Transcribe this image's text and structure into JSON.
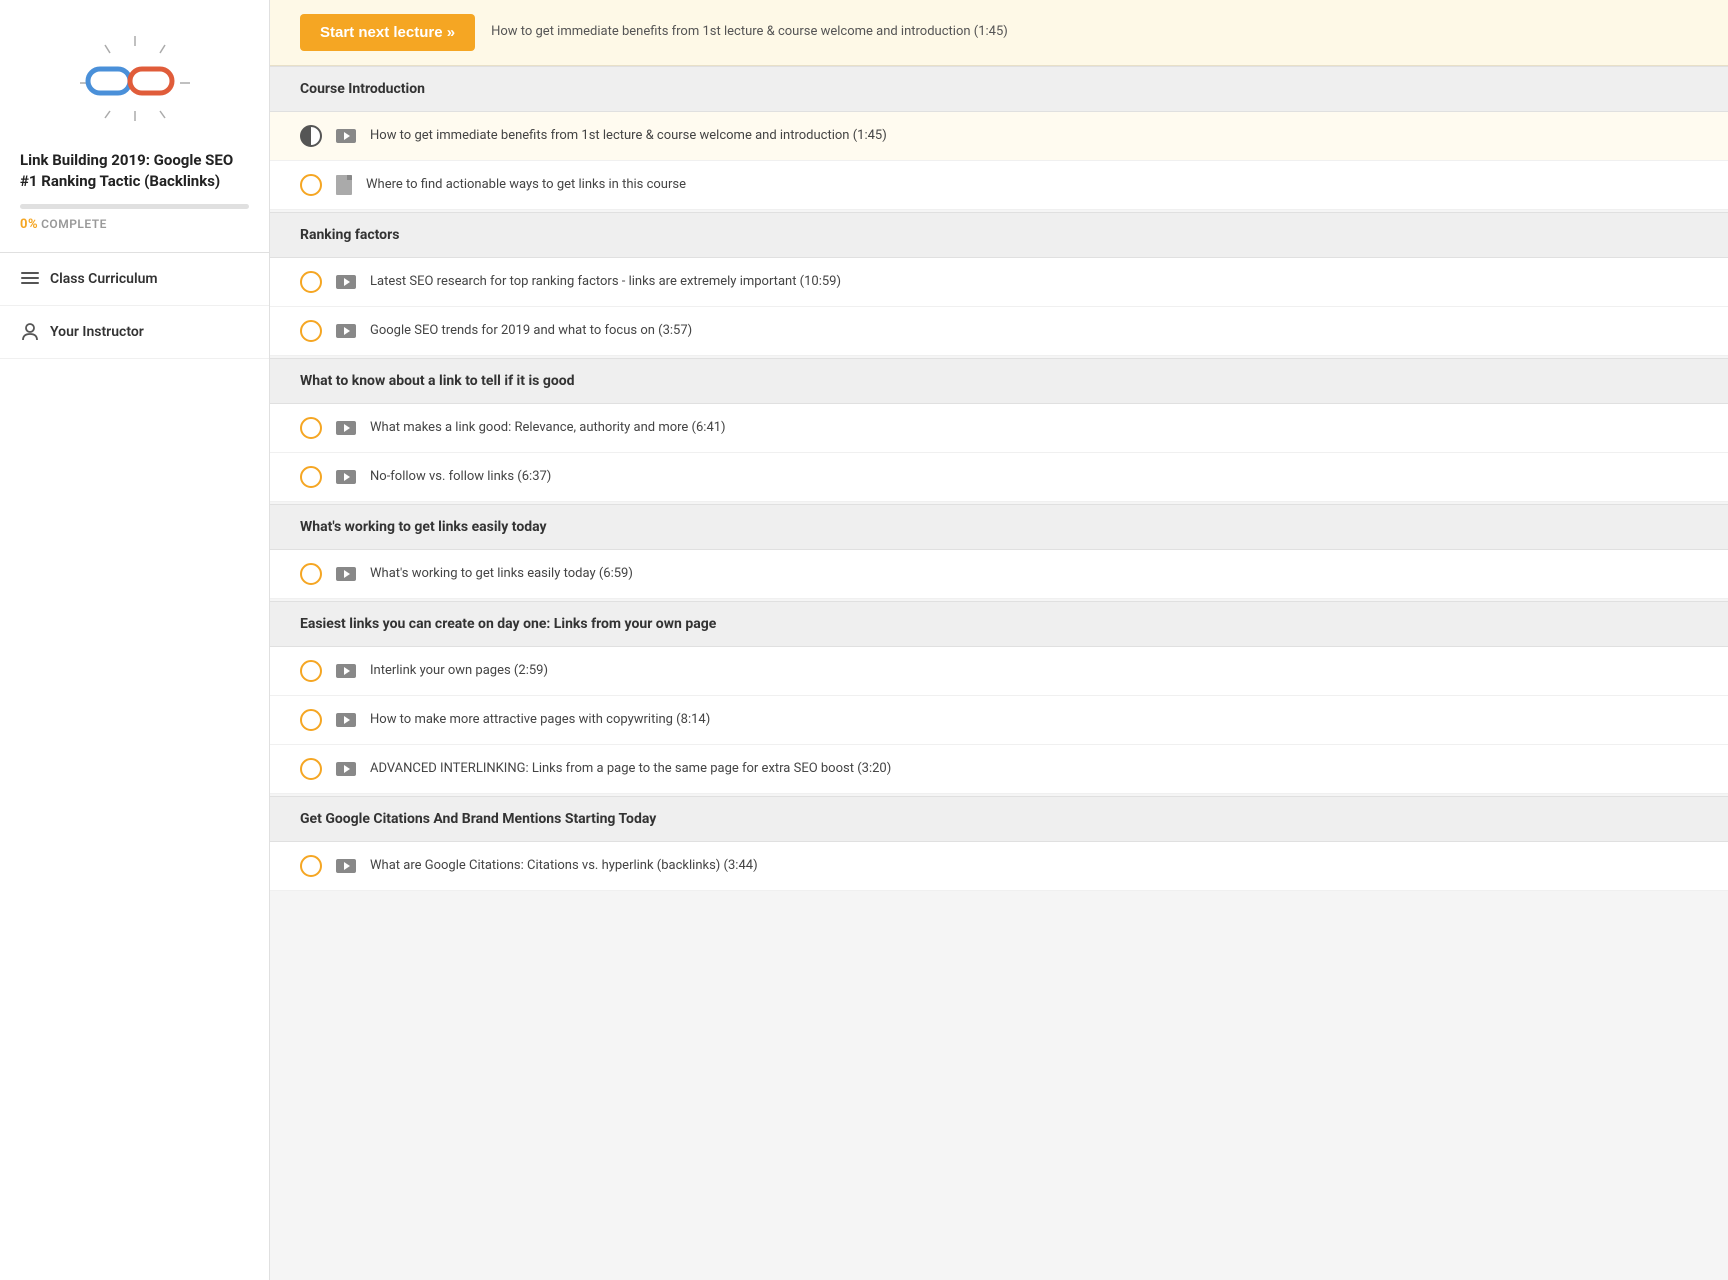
{
  "sidebar": {
    "course_title": "Link Building 2019: Google SEO #1 Ranking Tactic (Backlinks)",
    "progress_percent": 0,
    "progress_label": "0%",
    "complete_label": "COMPLETE",
    "nav_items": [
      {
        "id": "class-curriculum",
        "label": "Class Curriculum",
        "icon": "list-icon"
      },
      {
        "id": "your-instructor",
        "label": "Your Instructor",
        "icon": "person-icon"
      }
    ]
  },
  "main": {
    "start_banner": {
      "button_label": "Start next lecture »",
      "description": "How to get immediate benefits from 1st lecture & course welcome and introduction (1:45)"
    },
    "sections": [
      {
        "id": "course-introduction",
        "title": "Course Introduction",
        "lectures": [
          {
            "id": "lec-1",
            "type": "video",
            "text": "How to get immediate benefits from 1st lecture & course welcome and introduction (1:45)",
            "status": "half"
          },
          {
            "id": "lec-2",
            "type": "doc",
            "text": "Where to find actionable ways to get links in this course",
            "status": "empty"
          }
        ]
      },
      {
        "id": "ranking-factors",
        "title": "Ranking factors",
        "lectures": [
          {
            "id": "lec-3",
            "type": "video",
            "text": "Latest SEO research for top ranking factors - links are extremely important (10:59)",
            "status": "empty"
          },
          {
            "id": "lec-4",
            "type": "video",
            "text": "Google SEO trends for 2019 and what to focus on (3:57)",
            "status": "empty"
          }
        ]
      },
      {
        "id": "what-to-know",
        "title": "What to know about a link to tell if it is good",
        "lectures": [
          {
            "id": "lec-5",
            "type": "video",
            "text": "What makes a link good: Relevance, authority and more (6:41)",
            "status": "empty"
          },
          {
            "id": "lec-6",
            "type": "video",
            "text": "No-follow vs. follow links (6:37)",
            "status": "empty"
          }
        ]
      },
      {
        "id": "whats-working",
        "title": "What's working to get links easily today",
        "lectures": [
          {
            "id": "lec-7",
            "type": "video",
            "text": "What's working to get links easily today (6:59)",
            "status": "empty"
          }
        ]
      },
      {
        "id": "easiest-links",
        "title": "Easiest links you can create on day one: Links from your own page",
        "lectures": [
          {
            "id": "lec-8",
            "type": "video",
            "text": "Interlink your own pages (2:59)",
            "status": "empty"
          },
          {
            "id": "lec-9",
            "type": "video",
            "text": "How to make more attractive pages with copywriting (8:14)",
            "status": "empty"
          },
          {
            "id": "lec-10",
            "type": "video",
            "text": "ADVANCED INTERLINKING: Links from a page to the same page for extra SEO boost (3:20)",
            "status": "empty"
          }
        ]
      },
      {
        "id": "google-citations",
        "title": "Get Google Citations And Brand Mentions Starting Today",
        "lectures": [
          {
            "id": "lec-11",
            "type": "video",
            "text": "What are Google Citations: Citations vs. hyperlink (backlinks) (3:44)",
            "status": "empty"
          }
        ]
      }
    ]
  }
}
